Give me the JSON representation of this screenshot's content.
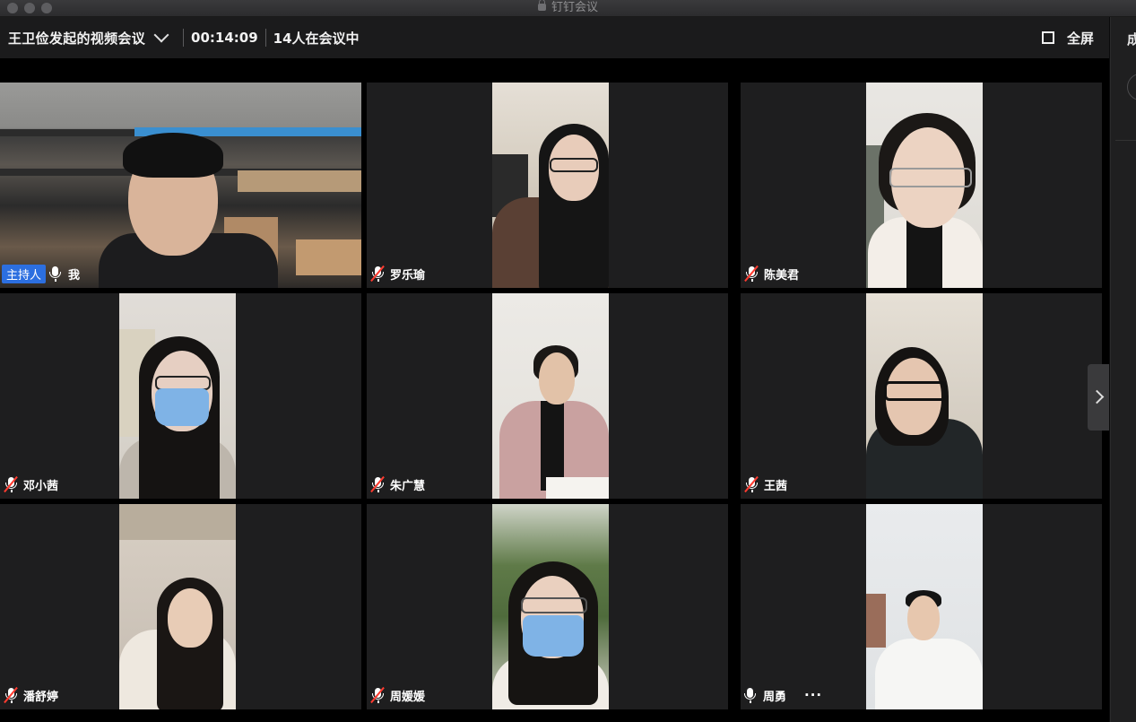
{
  "window": {
    "title": "钉钉会议"
  },
  "header": {
    "meeting_title": "王卫俭发起的视频会议",
    "elapsed": "00:14:09",
    "participant_count": "14人在会议中",
    "fullscreen_label": "全屏"
  },
  "side_panel": {
    "label": "成"
  },
  "tiles": [
    {
      "name": "我",
      "host_badge": "主持人",
      "mic": "on",
      "more": ""
    },
    {
      "name": "罗乐瑜",
      "mic": "muted"
    },
    {
      "name": "陈美君",
      "mic": "muted"
    },
    {
      "name": "邓小茜",
      "mic": "muted"
    },
    {
      "name": "朱广慧",
      "mic": "muted"
    },
    {
      "name": "王茜",
      "mic": "muted"
    },
    {
      "name": "潘舒婷",
      "mic": "muted"
    },
    {
      "name": "周媛媛",
      "mic": "muted"
    },
    {
      "name": "周勇",
      "mic": "on",
      "more": "···"
    }
  ],
  "colors": {
    "host_badge": "#2c6fe0",
    "muted_slash": "#ff3b30",
    "tile_bg": "#1e1e1f"
  }
}
